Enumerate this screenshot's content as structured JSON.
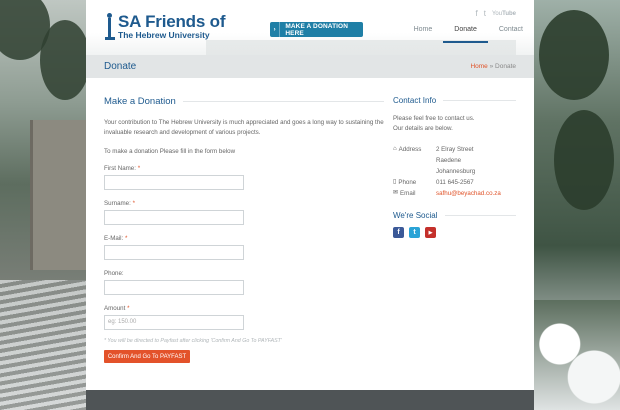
{
  "header": {
    "logo_line1": "SA Friends of",
    "logo_line2": "The Hebrew University",
    "cta_label": "MAKE A DONATION HERE",
    "social_icons": [
      "facebook-icon",
      "twitter-icon",
      "youtube-icon"
    ],
    "nav": [
      {
        "label": "Home",
        "active": false
      },
      {
        "label": "Donate",
        "active": true
      },
      {
        "label": "Contact",
        "active": false
      }
    ]
  },
  "titlebar": {
    "title": "Donate",
    "breadcrumb_home": "Home",
    "breadcrumb_sep": "»",
    "breadcrumb_current": "Donate"
  },
  "main": {
    "heading": "Make a Donation",
    "intro": "Your contribution to The Hebrew University is much appreciated and goes a long way to sustaining the invaluable research and development of various projects.",
    "instruction": "To make a donation Please fill in the form below",
    "fields": [
      {
        "label": "First Name:",
        "required": true,
        "value": "",
        "placeholder": ""
      },
      {
        "label": "Surname:",
        "required": true,
        "value": "",
        "placeholder": ""
      },
      {
        "label": "E-Mail:",
        "required": true,
        "value": "",
        "placeholder": ""
      },
      {
        "label": "Phone:",
        "required": false,
        "value": "",
        "placeholder": ""
      },
      {
        "label": "Amount",
        "required": true,
        "value": "",
        "placeholder": "eg: 150.00"
      }
    ],
    "required_mark": "*",
    "note": "* You will be directed to Payfast after clicking 'Confirm And Go To PAYFAST'",
    "submit_label": "Confirm And Go To PAYFAST"
  },
  "sidebar": {
    "contact_heading": "Contact Info",
    "contact_text1": "Please feel free to contact us.",
    "contact_text2": "Our details are below.",
    "address_label": "Address",
    "address_lines": [
      "2 Elray Street",
      "Raedene",
      "Johannesburg"
    ],
    "phone_label": "Phone",
    "phone": "011 645-2567",
    "email_label": "Email",
    "email": "safhu@beyachad.co.za",
    "social_heading": "We're Social",
    "social_icons": [
      "facebook-icon",
      "twitter-icon",
      "youtube-icon"
    ]
  },
  "colors": {
    "brand": "#1e5a8e",
    "accent": "#e3522a",
    "cta": "#1f7fa6",
    "footer": "#4f5456"
  }
}
